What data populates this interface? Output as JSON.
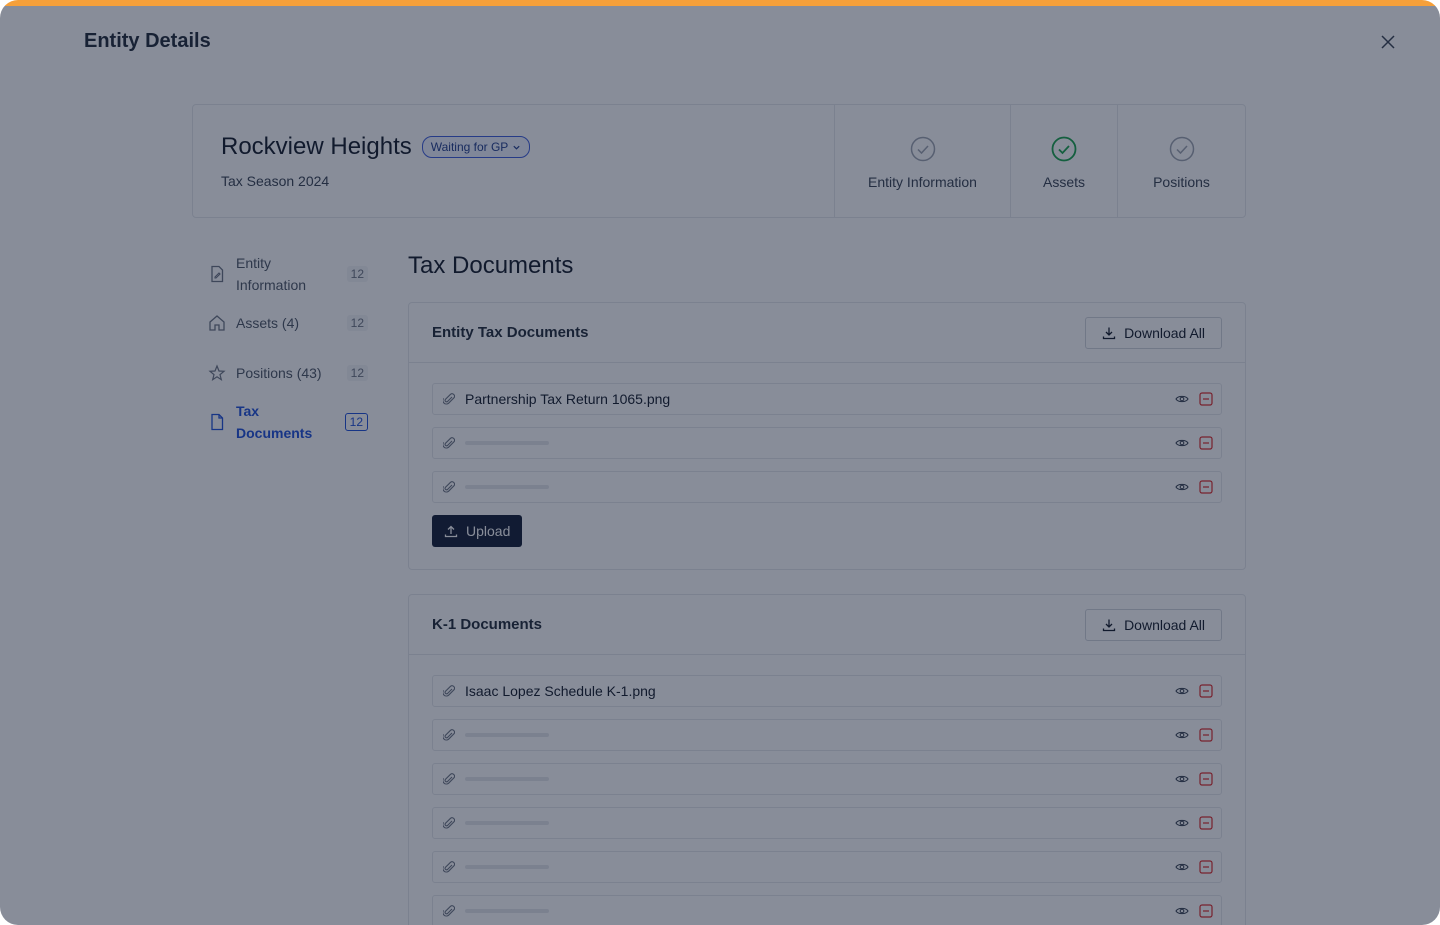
{
  "modal": {
    "title": "Entity Details"
  },
  "entity": {
    "name": "Rockview Heights",
    "status": "Waiting for GP",
    "season": "Tax Season 2024"
  },
  "steps": [
    {
      "label": "Entity Information",
      "done": false
    },
    {
      "label": "Assets",
      "done": true
    },
    {
      "label": "Positions",
      "done": false
    }
  ],
  "sidebar": {
    "items": [
      {
        "label": "Entity Information",
        "count": "12",
        "icon": "edit-document-icon"
      },
      {
        "label": "Assets (4)",
        "count": "12",
        "icon": "home-icon"
      },
      {
        "label": "Positions (43)",
        "count": "12",
        "icon": "star-icon"
      },
      {
        "label": "Tax Documents",
        "count": "12",
        "icon": "document-icon",
        "active": true
      }
    ]
  },
  "main": {
    "title": "Tax Documents",
    "entity_docs": {
      "title": "Entity Tax Documents",
      "download_label": "Download All",
      "upload_label": "Upload",
      "files": [
        "Partnership Tax Return 1065.png"
      ]
    },
    "k1_docs": {
      "title": "K-1 Documents",
      "download_label": "Download All",
      "files": [
        "Isaac Lopez Schedule K-1.png"
      ]
    }
  },
  "colors": {
    "accent": "#f6a03a",
    "primary": "#111b33",
    "link": "#1d4ed8",
    "success": "#16a34a",
    "danger": "#dc2626"
  }
}
